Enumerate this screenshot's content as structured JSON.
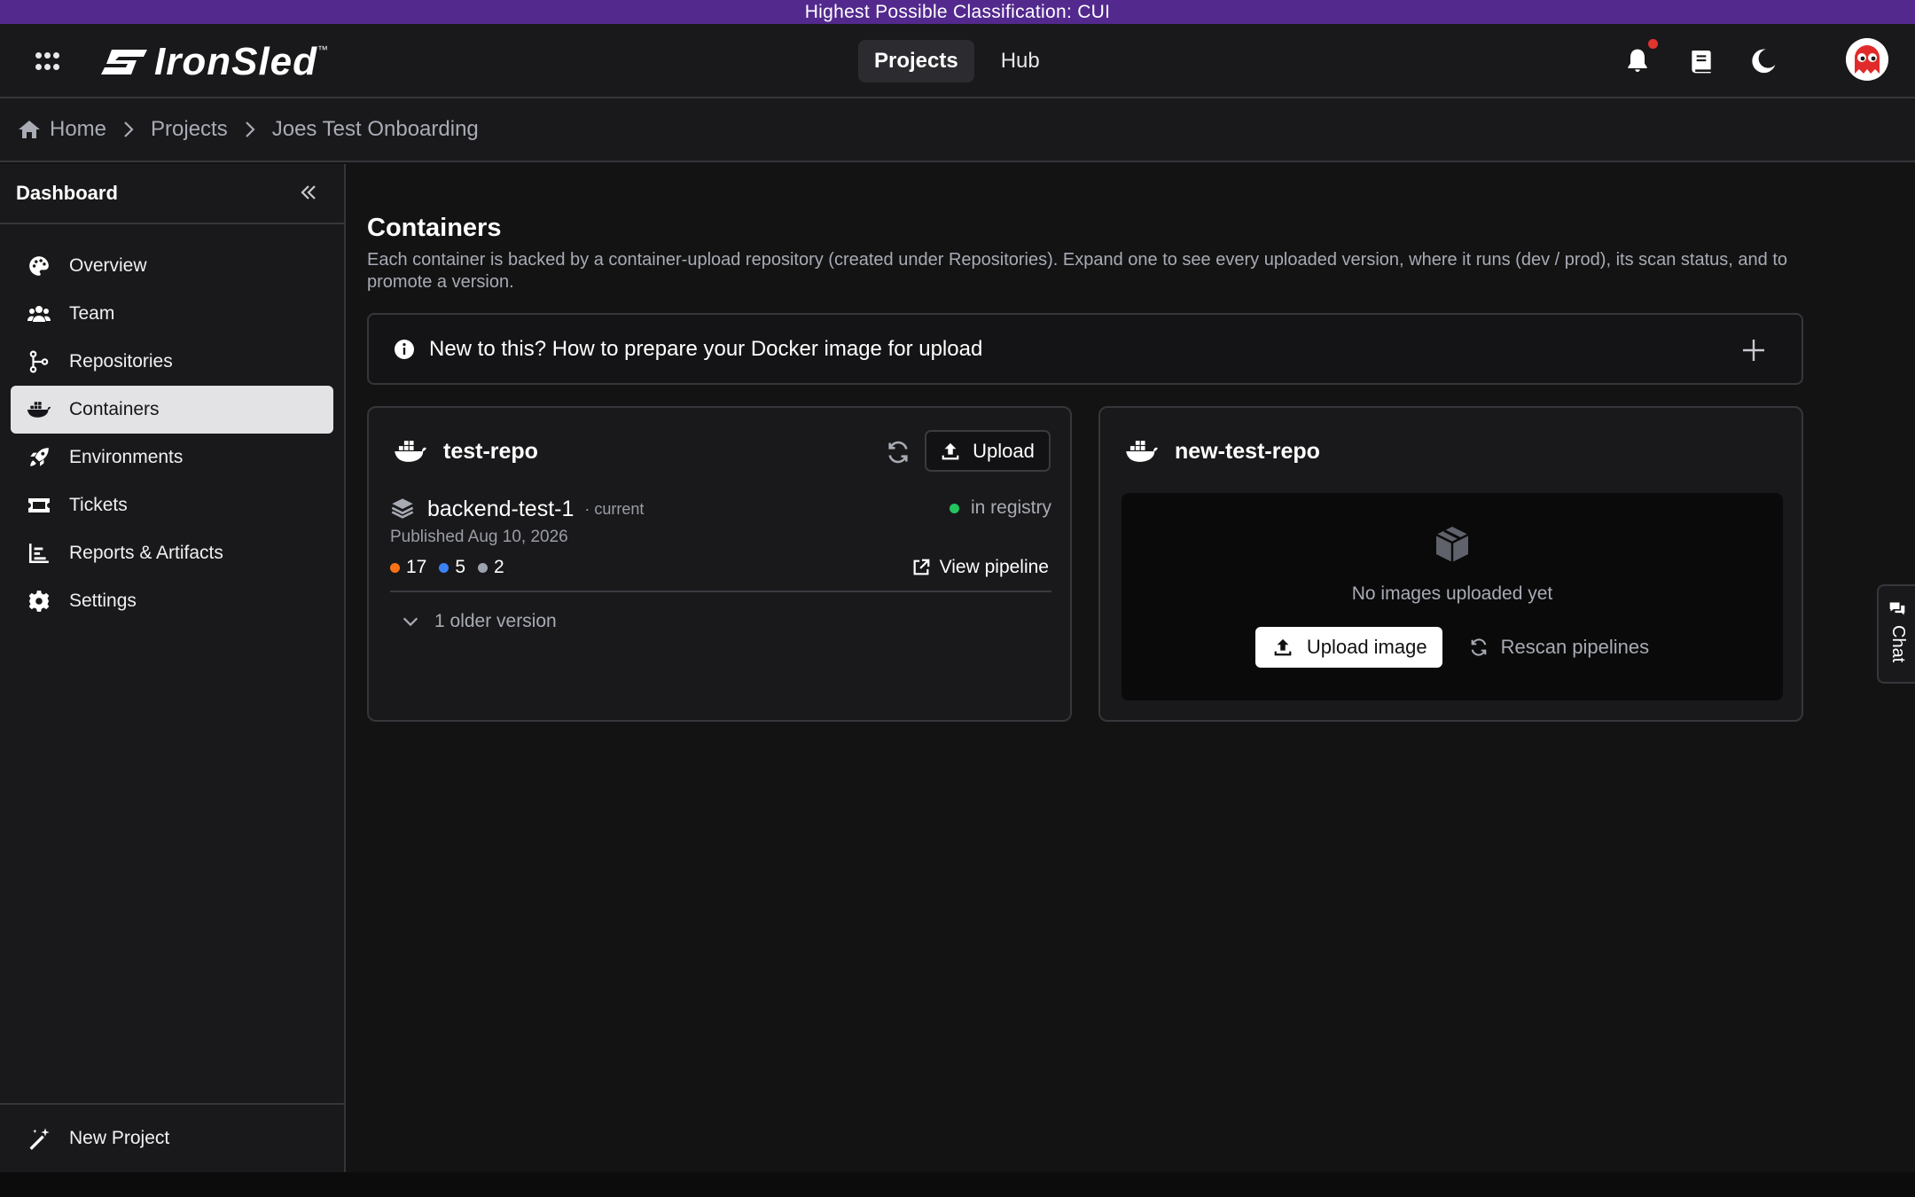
{
  "banner": {
    "text": "Highest Possible Classification: CUI"
  },
  "app": {
    "logo_text": "IronSled",
    "logo_tm": "™"
  },
  "topnav": {
    "items": [
      {
        "label": "Projects",
        "active": true
      },
      {
        "label": "Hub",
        "active": false
      }
    ]
  },
  "breadcrumb": {
    "items": [
      "Home",
      "Projects",
      "Joes Test Onboarding"
    ]
  },
  "sidebar": {
    "title": "Dashboard",
    "items": [
      {
        "label": "Overview",
        "icon": "palette-icon"
      },
      {
        "label": "Team",
        "icon": "users-icon"
      },
      {
        "label": "Repositories",
        "icon": "git-branch-icon"
      },
      {
        "label": "Containers",
        "icon": "docker-icon",
        "active": true
      },
      {
        "label": "Environments",
        "icon": "rocket-icon"
      },
      {
        "label": "Tickets",
        "icon": "ticket-icon"
      },
      {
        "label": "Reports & Artifacts",
        "icon": "chart-icon"
      },
      {
        "label": "Settings",
        "icon": "gear-icon"
      }
    ],
    "footer_label": "New Project"
  },
  "main": {
    "title": "Containers",
    "description": "Each container is backed by a container-upload repository (created under Repositories). Expand one to see every uploaded version, where it runs (dev / prod), its scan status, and to promote a version.",
    "help_text": "New to this? How to prepare your Docker image for upload"
  },
  "cards": [
    {
      "name": "test-repo",
      "upload_label": "Upload",
      "version": {
        "name": "backend-test-1",
        "tag": "· current",
        "status": "in registry",
        "published": "Published Aug 10, 2026",
        "counts": [
          {
            "value": "17",
            "color": "#f97316"
          },
          {
            "value": "5",
            "color": "#3b82f6"
          },
          {
            "value": "2",
            "color": "#9ca3af"
          }
        ],
        "pipeline_label": "View pipeline"
      },
      "older_label": "1 older version"
    },
    {
      "name": "new-test-repo",
      "empty_text": "No images uploaded yet",
      "upload_image_label": "Upload image",
      "rescan_label": "Rescan pipelines"
    }
  ],
  "chat": {
    "label": "Chat"
  },
  "colors": {
    "accent": "#53298e",
    "status_ok": "#22c55e",
    "bell_dot": "#e0342f"
  }
}
